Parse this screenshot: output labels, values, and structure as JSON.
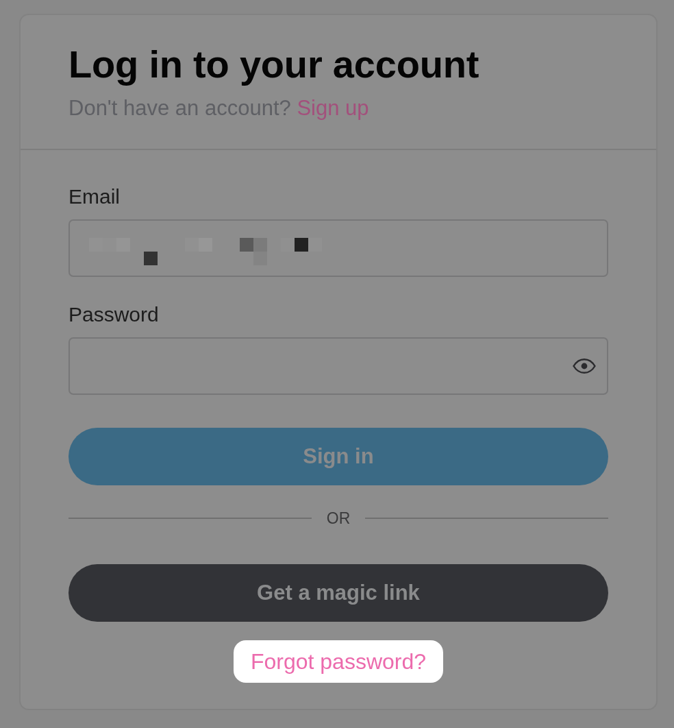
{
  "card": {
    "title": "Log in to your account",
    "subtitle": {
      "text": "Don't have an account?",
      "link": "Sign up"
    }
  },
  "fields": [
    {
      "label": "Email",
      "value_redacted": true
    },
    {
      "label": "Password",
      "reveal_toggle": true
    }
  ],
  "sign_in_button": {
    "label": "Sign in"
  },
  "divider": {
    "text": "OR"
  },
  "magic_link_button": {
    "label": "Get a magic link"
  },
  "forgot_link": {
    "label": "Forgot password?",
    "highlighted": true
  }
}
